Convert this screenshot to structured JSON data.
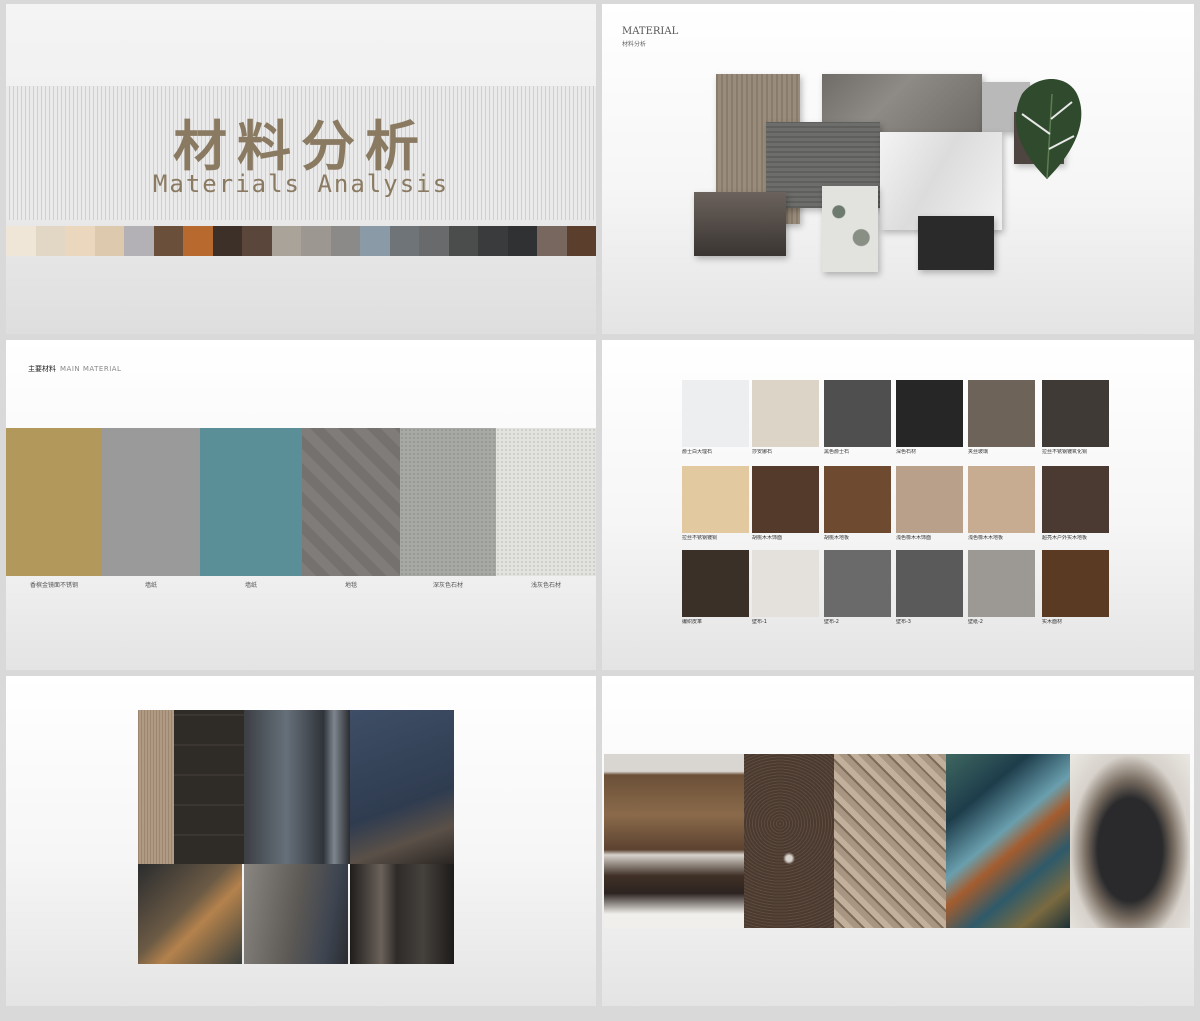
{
  "slide1": {
    "title_cn": "材料分析",
    "title_en": "Materials Analysis",
    "swatches": [
      "#efe6d8",
      "#e2d6c4",
      "#ead7bd",
      "#ddc9ad",
      "#b3b0b6",
      "#6a4f3a",
      "#b86a2e",
      "#3c3028",
      "#5a463a",
      "#a9a39a",
      "#9c9891",
      "#8b8a88",
      "#8a9aa7",
      "#6f7479",
      "#686a6c",
      "#4b4c4c",
      "#3a3b3d",
      "#2f3133",
      "#77675e",
      "#5c3e2c"
    ]
  },
  "slide2": {
    "title": "MATERIAL",
    "subtitle": "材料分析"
  },
  "slide3": {
    "heading_cn": "主要材料",
    "heading_en": "MAIN MATERIAL",
    "materials": [
      {
        "label": "香槟金镜面不锈钢",
        "color": "#b3985c"
      },
      {
        "label": "墙纸",
        "color": "#9a9a9a"
      },
      {
        "label": "墙纸",
        "color": "#5b8f97"
      },
      {
        "label": "地毯",
        "color": "#75716e"
      },
      {
        "label": "深灰色石材",
        "color": "#a7a9a5"
      },
      {
        "label": "浅灰色石材",
        "color": "#e2e3df"
      }
    ]
  },
  "slide4": {
    "items": [
      {
        "label": "爵士白大理石",
        "color": "#eceeef"
      },
      {
        "label": "莎安娜石",
        "color": "#ddd4c8"
      },
      {
        "label": "黑色爵士石",
        "color": "#4f4f4f"
      },
      {
        "label": "深色石材",
        "color": "#262626"
      },
      {
        "label": "夹丝玻璃",
        "color": "#6e6358"
      },
      {
        "label": "拉丝不锈钢镀氧化铜",
        "color": "#403a36"
      },
      {
        "label": "拉丝不锈钢镀铜",
        "color": "#e2c9a0"
      },
      {
        "label": "胡桃木木饰面",
        "color": "#533a2a"
      },
      {
        "label": "胡桃木地板",
        "color": "#6e4a30"
      },
      {
        "label": "浅色橡木木饰面",
        "color": "#b9a08a"
      },
      {
        "label": "浅色橡木木地板",
        "color": "#c7ac92"
      },
      {
        "label": "超亮木户外实木地板",
        "color": "#4b3a32"
      },
      {
        "label": "编织皮革",
        "color": "#3a3028"
      },
      {
        "label": "壁布-1",
        "color": "#e4e1dc"
      },
      {
        "label": "壁布-2",
        "color": "#6a6a6a"
      },
      {
        "label": "壁布-3",
        "color": "#5a5a5a"
      },
      {
        "label": "壁纸-2",
        "color": "#9c9894"
      },
      {
        "label": "实木面材",
        "color": "#5a3a22"
      }
    ]
  },
  "slide5": {},
  "slide6": {}
}
